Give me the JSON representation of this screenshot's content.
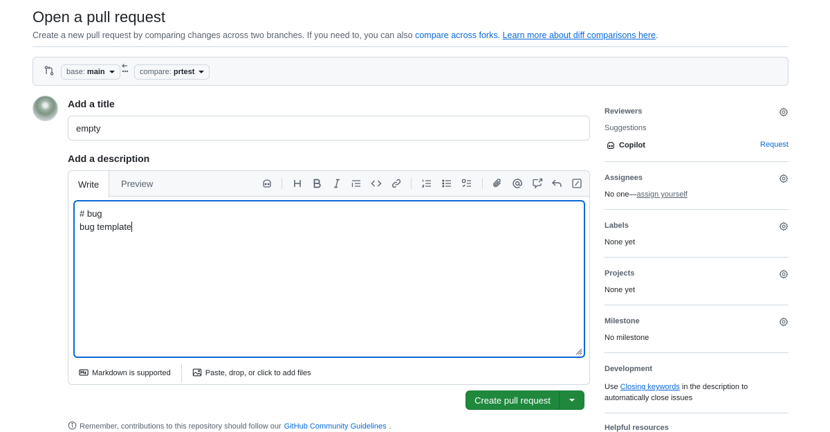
{
  "header": {
    "title": "Open a pull request",
    "subtitle_prefix": "Create a new pull request by comparing changes across two branches. If you need to, you can also ",
    "compare_forks_link": "compare across forks.",
    "learn_more_link": "Learn more about diff comparisons here",
    "subtitle_suffix": "."
  },
  "compare": {
    "base_prefix": "base:",
    "base_branch": "main",
    "compare_prefix": "compare:",
    "compare_branch": "prtest"
  },
  "form": {
    "title_label": "Add a title",
    "title_value": "empty",
    "description_label": "Add a description",
    "tabs": [
      "Write",
      "Preview"
    ],
    "body_lines": [
      "# bug",
      "",
      "bug template"
    ],
    "markdown_note": "Markdown is supported",
    "attach_note": "Paste, drop, or click to add files",
    "create_button": "Create pull request",
    "remember_prefix": "Remember, contributions to this repository should follow our ",
    "remember_link": "GitHub Community Guidelines",
    "remember_suffix": "."
  },
  "sidebar": {
    "reviewers": {
      "title": "Reviewers",
      "suggestions_label": "Suggestions",
      "suggestion_name": "Copilot",
      "request_link": "Request"
    },
    "assignees": {
      "title": "Assignees",
      "none_prefix": "No one—",
      "assign_link": "assign yourself"
    },
    "labels": {
      "title": "Labels",
      "value": "None yet"
    },
    "projects": {
      "title": "Projects",
      "value": "None yet"
    },
    "milestone": {
      "title": "Milestone",
      "value": "No milestone"
    },
    "development": {
      "title": "Development",
      "text_prefix": "Use ",
      "link": "Closing keywords",
      "text_suffix": " in the description to",
      "text_line2": "automatically close issues"
    },
    "helpful_title": "Helpful resources"
  },
  "colors": {
    "accent": "#0969da",
    "primary_button": "#1f883d",
    "border": "#d1d9e0",
    "muted": "#59636e"
  },
  "icons": [
    "compare-icon",
    "arrow-left-icon",
    "copilot-icon",
    "heading-icon",
    "bold-icon",
    "italic-icon",
    "quote-icon",
    "code-icon",
    "link-icon",
    "ordered-list-icon",
    "unordered-list-icon",
    "task-list-icon",
    "attach-icon",
    "mention-icon",
    "cross-reference-icon",
    "reply-icon",
    "slash-command-icon",
    "markdown-icon",
    "image-icon",
    "gear-icon",
    "info-icon"
  ]
}
